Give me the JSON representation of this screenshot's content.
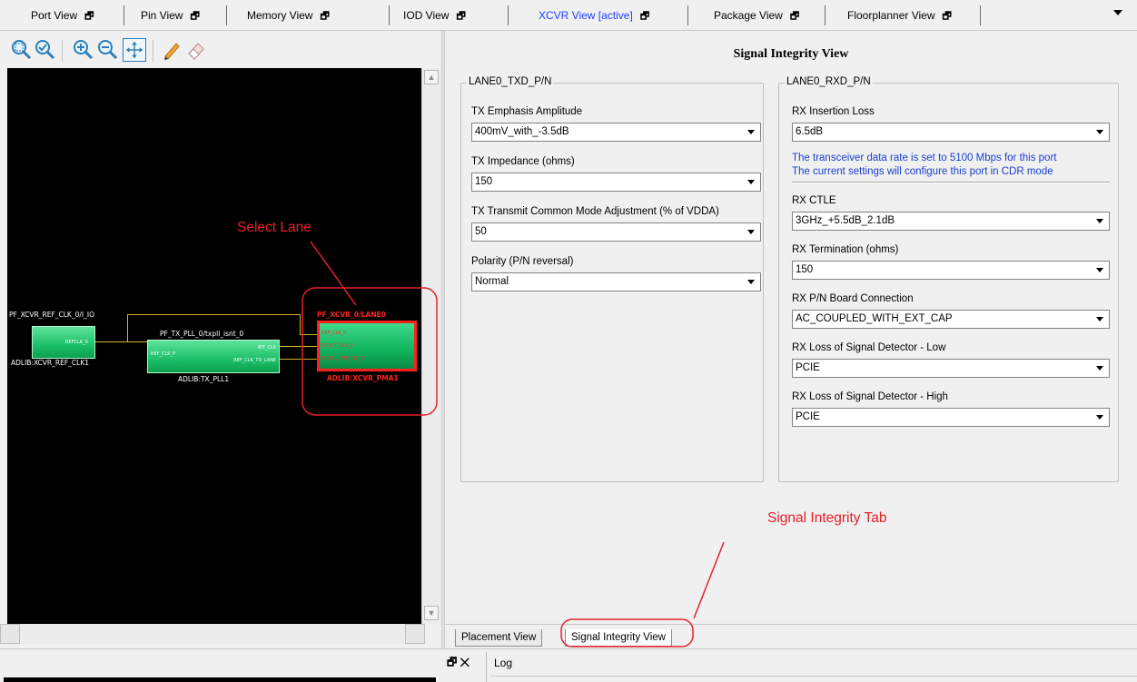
{
  "tabs": [
    {
      "label": "Port View",
      "active": false
    },
    {
      "label": "Pin View",
      "active": false
    },
    {
      "label": "Memory View",
      "active": false
    },
    {
      "label": "IOD View",
      "active": false
    },
    {
      "label": "XCVR View [active]",
      "active": true
    },
    {
      "label": "Package View",
      "active": false
    },
    {
      "label": "Floorplanner View",
      "active": false
    }
  ],
  "tab_pin_glyph": "🗗",
  "toolbar_icons": [
    "zoom-fit-icon",
    "zoom-area-icon",
    "zoom-in-icon",
    "zoom-out-icon",
    "pan-icon",
    "pencil-icon",
    "eraser-icon"
  ],
  "canvas": {
    "ref_clk_port": "PF_XCVR_REF_CLK_0/I_IO",
    "ref_clk_block_pin": "REFCLK_0",
    "ref_clk_block_name": "ADLIB:XCVR_REF_CLK1",
    "pll_instance": "PF_TX_PLL_0/txpll_isnt_0",
    "pll_pin_ref_clk": "REF_CLK_P",
    "pll_pin_bit_clk": "BIT_CLK",
    "pll_pin_ref_clk_to_lane": "REF_CLK_TO_LANE",
    "pll_block_name": "ADLIB:TX_PLL1",
    "lane_instance": "PF_XCVR_0/LANE0",
    "lane_pin_ref_clk": "REF_CLK_P",
    "lane_pin_bit_clk": "TX_BIT_CLK_0",
    "lane_pin_pll_ref": "TX_PLL_REF_CLK_0",
    "lane_block_name": "ADLIB:XCVR_PMA1"
  },
  "panel": {
    "title": "Signal Integrity View",
    "tx_group": {
      "title": "LANE0_TXD_P/N",
      "fields": [
        {
          "label": "TX Emphasis Amplitude",
          "value": "400mV_with_-3.5dB"
        },
        {
          "label": "TX Impedance (ohms)",
          "value": "150"
        },
        {
          "label": "TX Transmit Common Mode Adjustment (% of VDDA)",
          "value": "50"
        },
        {
          "label": "Polarity (P/N reversal)",
          "value": "Normal"
        }
      ]
    },
    "rx_group": {
      "title": "LANE0_RXD_P/N",
      "insertion_loss_label": "RX Insertion Loss",
      "insertion_loss_value": "6.5dB",
      "info_line1": "The transceiver data rate is set to 5100 Mbps for this port",
      "info_line2": "The current settings will configure this port in CDR mode",
      "fields": [
        {
          "label": "RX CTLE",
          "value": "3GHz_+5.5dB_2.1dB"
        },
        {
          "label": "RX Termination (ohms)",
          "value": "150"
        },
        {
          "label": "RX P/N Board Connection",
          "value": "AC_COUPLED_WITH_EXT_CAP"
        },
        {
          "label": "RX Loss of Signal Detector - Low",
          "value": "PCIE"
        },
        {
          "label": "RX Loss of Signal Detector - High",
          "value": "PCIE"
        }
      ]
    }
  },
  "bottom_tabs": [
    {
      "label": "Placement View",
      "selected": false
    },
    {
      "label": "Signal Integrity View",
      "selected": true
    }
  ],
  "annotations": {
    "select_lane": "Select Lane",
    "signal_integrity_tab": "Signal Integrity Tab",
    "color": "#e8202a"
  },
  "log": {
    "label": "Log",
    "icons": "🗗 ✕"
  }
}
